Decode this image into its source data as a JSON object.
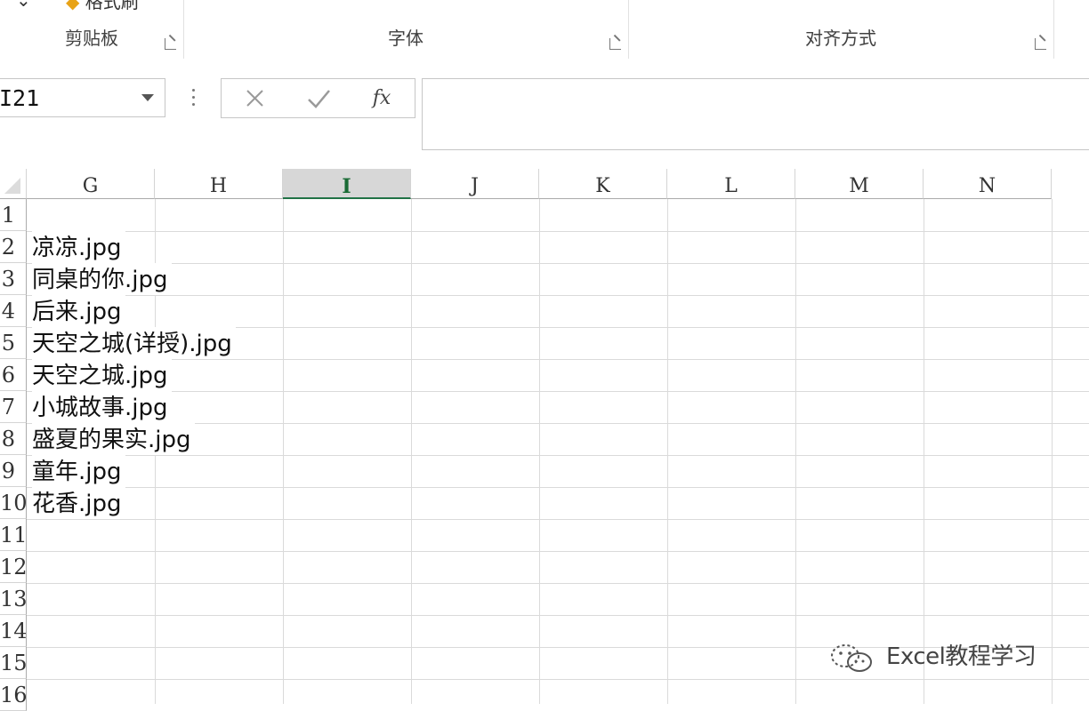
{
  "ribbon": {
    "groups": [
      {
        "label": "剪贴板"
      },
      {
        "label": "字体"
      },
      {
        "label": "对齐方式"
      }
    ],
    "format_painter_label": "格式刷"
  },
  "formula_bar": {
    "name_box": "I21",
    "fx_label": "fx",
    "formula_value": ""
  },
  "sheet": {
    "columns": [
      "G",
      "H",
      "I",
      "J",
      "K",
      "L",
      "M",
      "N"
    ],
    "selected_column": "I",
    "row_numbers": [
      "1",
      "2",
      "3",
      "4",
      "5",
      "6",
      "7",
      "8",
      "9",
      "10",
      "11",
      "12",
      "13",
      "14",
      "15",
      "16"
    ],
    "column_g_cells": [
      "",
      "凉凉.jpg",
      "同桌的你.jpg",
      "后来.jpg",
      "天空之城(详授).jpg",
      "天空之城.jpg",
      "小城故事.jpg",
      "盛夏的果实.jpg",
      "童年.jpg",
      "花香.jpg"
    ]
  },
  "watermark": {
    "text": "Excel教程学习",
    "icon": "wechat-icon"
  },
  "colors": {
    "accent": "#217346",
    "selected_header_bg": "#d7d7d7",
    "gridline": "#dadada"
  }
}
